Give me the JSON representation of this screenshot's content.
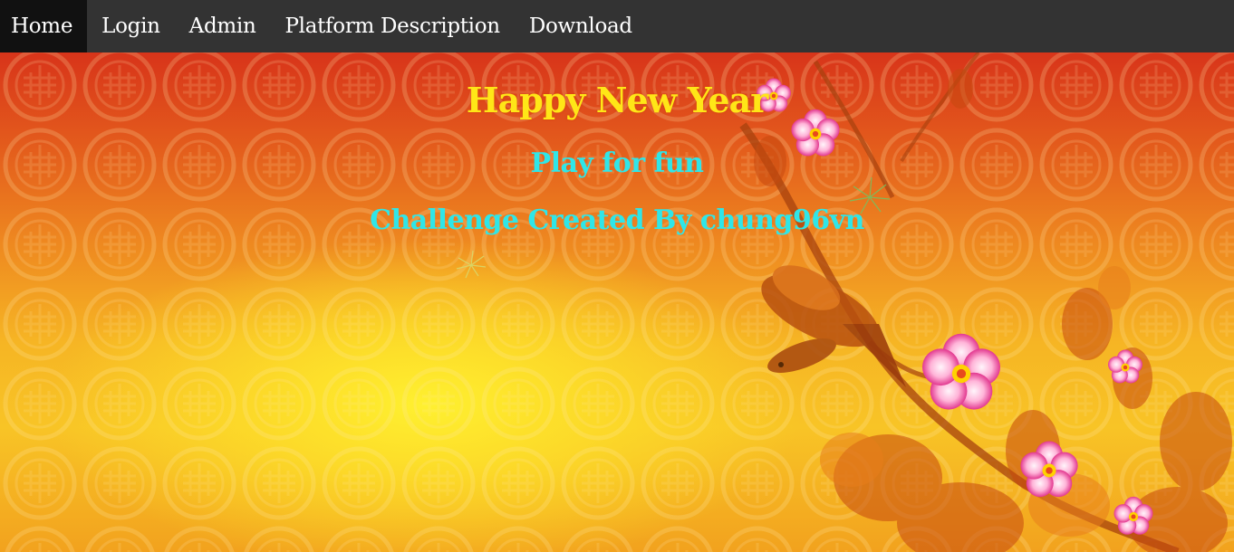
{
  "nav": {
    "items": [
      {
        "label": "Home",
        "active": true
      },
      {
        "label": "Login"
      },
      {
        "label": "Admin"
      },
      {
        "label": "Platform Description"
      },
      {
        "label": "Download"
      }
    ]
  },
  "hero": {
    "title": "Happy New Year",
    "subtitle": "Play for fun",
    "credit": "Challenge Created By chung96vn"
  },
  "colors": {
    "navbar": "#333333",
    "nav_active": "#111111",
    "title": "#ffe617",
    "subtitle": "#2fe6e8"
  }
}
